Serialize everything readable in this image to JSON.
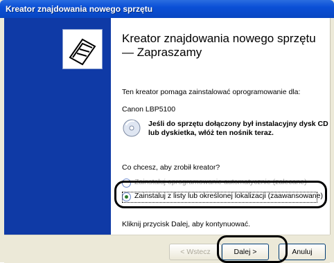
{
  "window": {
    "title": "Kreator znajdowania nowego sprzętu"
  },
  "main": {
    "heading": "Kreator znajdowania nowego sprzętu — Zapraszamy",
    "intro": "Ten kreator pomaga zainstalować oprogramowanie dla:",
    "device": "Canon LBP5100",
    "cd_prompt": "Jeśli do sprzętu dołączony był instalacyjny dysk CD lub dyskietka, włóż ten nośnik teraz.",
    "question": "Co chcesz, aby zrobił kreator?",
    "options": [
      {
        "label": "Zainstaluj oprogramowanie automatycznie (zalecane)",
        "selected": false
      },
      {
        "label": "Zainstaluj z listy lub określonej lokalizacji (zaawansowane)",
        "selected": true
      }
    ],
    "continue_hint": "Kliknij przycisk Dalej, aby kontynuować."
  },
  "buttons": {
    "back": "< Wstecz",
    "next": "Dalej >",
    "cancel": "Anuluj"
  },
  "icons": {
    "wizard": "hardware-wizard-icon",
    "cd": "cd-icon"
  },
  "colors": {
    "titlebar": "#0a4fd6",
    "left_panel": "#0f3aa6",
    "window_bg": "#ece9d8",
    "highlight": "#000000"
  }
}
